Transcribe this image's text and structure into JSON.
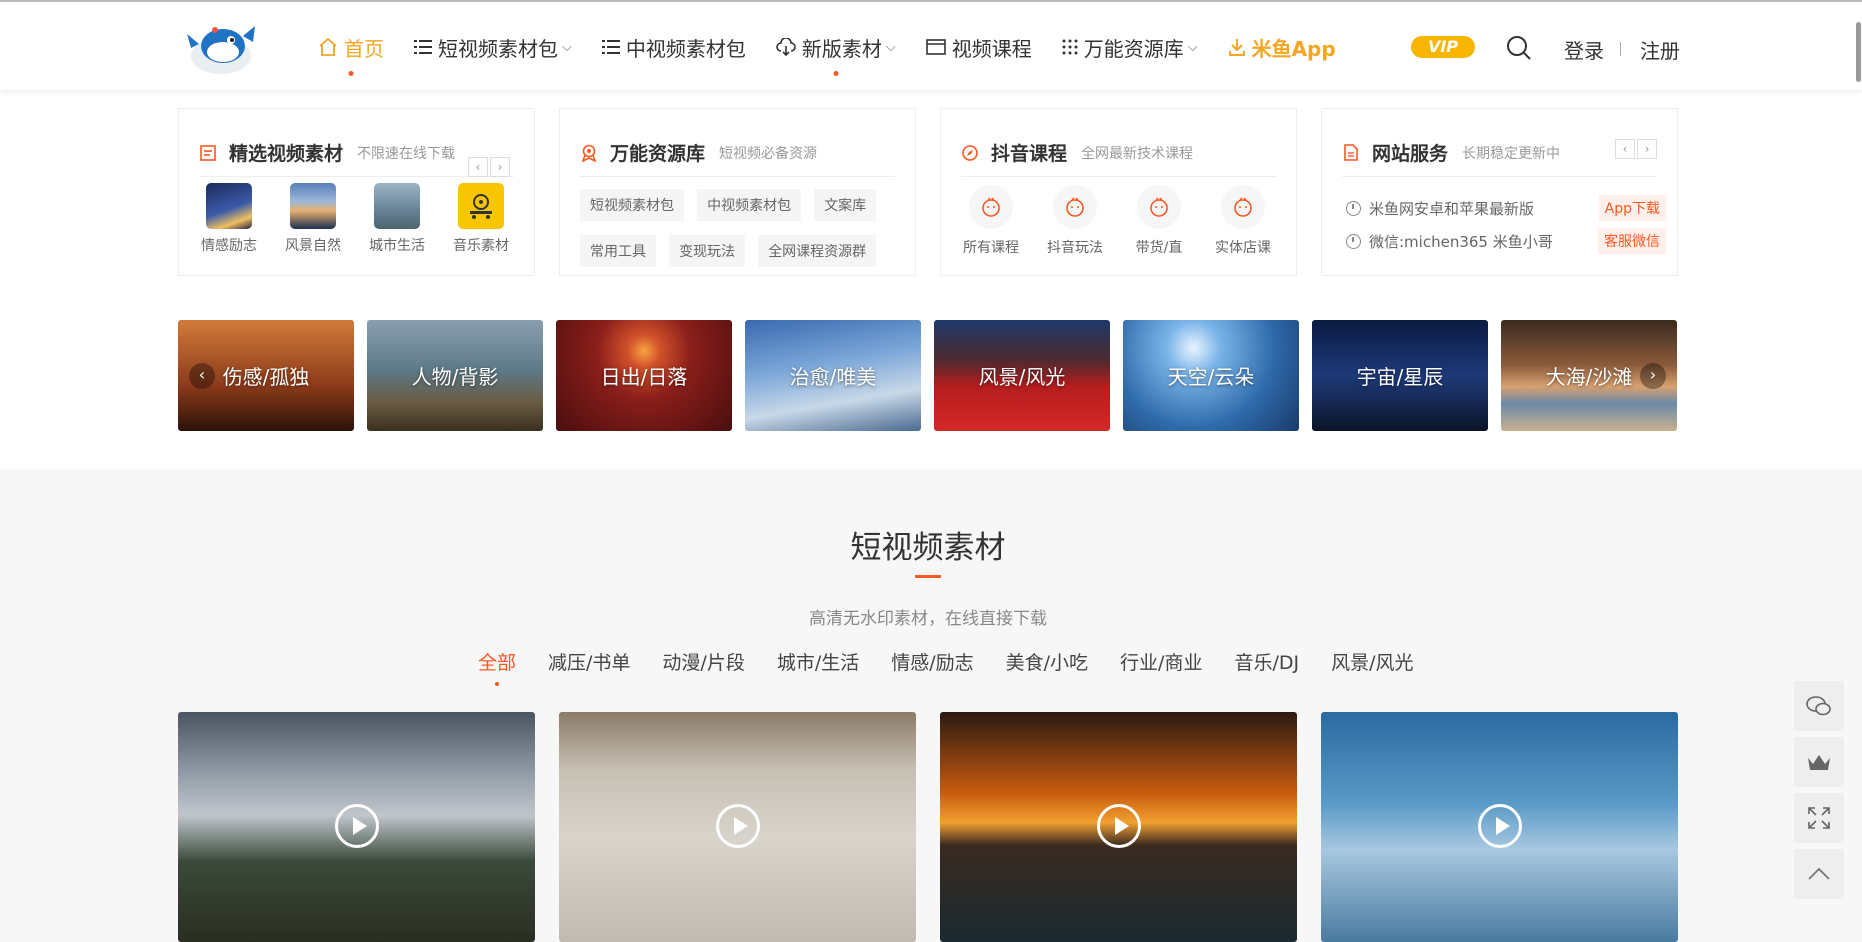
{
  "header": {
    "nav": [
      {
        "label": "首页",
        "icon": "home-icon",
        "active": true
      },
      {
        "label": "短视频素材包",
        "icon": "list-icon",
        "caret": true
      },
      {
        "label": "中视频素材包",
        "icon": "list-icon"
      },
      {
        "label": "新版素材",
        "icon": "cloud-download-icon",
        "caret": true,
        "dot": true
      },
      {
        "label": "视频课程",
        "icon": "video-icon"
      },
      {
        "label": "万能资源库",
        "icon": "grid-icon",
        "caret": true
      },
      {
        "label": "米鱼App",
        "icon": "download-icon",
        "highlight": true
      }
    ],
    "vip": "VIP",
    "login": "登录",
    "register": "注册"
  },
  "cards": {
    "featured": {
      "title": "精选视频素材",
      "subtitle": "不限速在线下载",
      "items": [
        {
          "label": "情感励志"
        },
        {
          "label": "风景自然"
        },
        {
          "label": "城市生活"
        },
        {
          "label": "音乐素材"
        }
      ]
    },
    "resources": {
      "title": "万能资源库",
      "subtitle": "短视频必备资源",
      "tags": [
        "短视频素材包",
        "中视频素材包",
        "文案库",
        "常用工具",
        "变现玩法",
        "全网课程资源群"
      ]
    },
    "douyin": {
      "title": "抖音课程",
      "subtitle": "全网最新技术课程",
      "items": [
        {
          "label": "所有课程"
        },
        {
          "label": "抖音玩法"
        },
        {
          "label": "带货/直"
        },
        {
          "label": "实体店课"
        }
      ]
    },
    "service": {
      "title": "网站服务",
      "subtitle": "长期稳定更新中",
      "rows": [
        {
          "text": "米鱼网安卓和苹果最新版",
          "button": "App下载"
        },
        {
          "text": "微信:michen365 米鱼小哥",
          "button": "客服微信"
        }
      ]
    }
  },
  "banners": [
    "伤感/孤独",
    "人物/背影",
    "日出/日落",
    "治愈/唯美",
    "风景/风光",
    "天空/云朵",
    "宇宙/星辰",
    "大海/沙滩"
  ],
  "section": {
    "title": "短视频素材",
    "subtitle": "高清无水印素材，在线直接下载",
    "tabs": [
      "全部",
      "减压/书单",
      "动漫/片段",
      "城市/生活",
      "情感/励志",
      "美食/小吃",
      "行业/商业",
      "音乐/DJ",
      "风景/风光"
    ]
  },
  "colors": {
    "accent": "#ff5722",
    "brand": "#f5a623",
    "vip": "#f7b500"
  }
}
